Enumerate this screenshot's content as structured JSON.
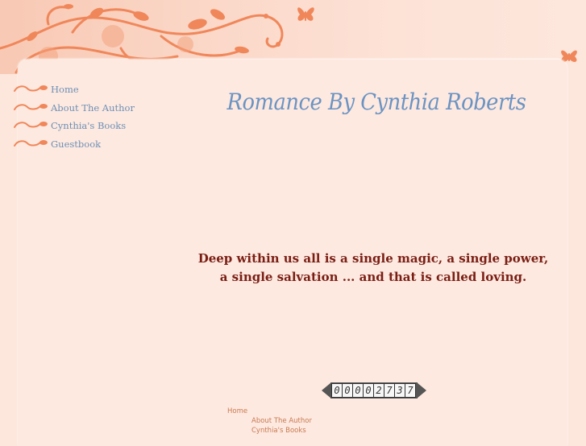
{
  "site": {
    "title": "Romance By Cynthia Roberts",
    "quote": "Deep within us all is a single magic, a single power, a single salvation ... and that is called loving."
  },
  "nav": {
    "items": [
      {
        "label": "Home"
      },
      {
        "label": "About The Author"
      },
      {
        "label": "Cynthia's Books"
      },
      {
        "label": "Guestbook"
      }
    ]
  },
  "counter": {
    "digits": [
      "0",
      "0",
      "0",
      "0",
      "2",
      "7",
      "3",
      "7"
    ]
  },
  "footer": {
    "links": [
      {
        "label": "Home"
      },
      {
        "label": "About The Author"
      },
      {
        "label": "Cynthia's Books"
      }
    ]
  },
  "colors": {
    "background": "#fde6dc",
    "nav_link": "#6e8fb5",
    "title": "#6b93c2",
    "quote": "#7a1e14",
    "ornament": "#f0875a",
    "footer_link": "#c97a52"
  },
  "icons": {
    "nav_bullet": "swirl-icon",
    "banner_decoration": "butterfly-icon"
  }
}
